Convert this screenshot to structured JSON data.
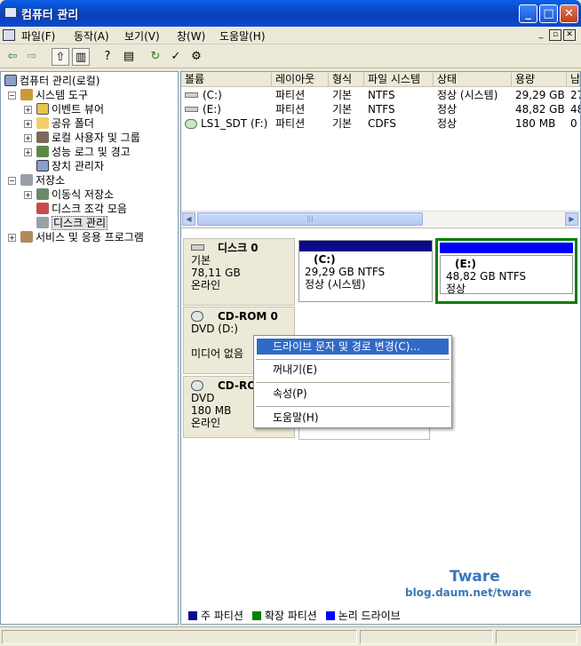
{
  "window": {
    "title": "컴퓨터 관리"
  },
  "menu": [
    "파일(F)",
    "동작(A)",
    "보기(V)",
    "창(W)",
    "도움말(H)"
  ],
  "colors": {
    "primary": "#0A0A8A",
    "extended": "#008000",
    "logical": "#0000FF",
    "selected_border": "#008000",
    "highlight": "#316AC5"
  },
  "tree": {
    "root": "컴퓨터 관리(로컬)",
    "system_tools": "시스템 도구",
    "event_viewer": "이벤트 뷰어",
    "shared_folders": "공유 폴더",
    "local_users": "로컬 사용자 및 그룹",
    "perf_logs": "성능 로그 및 경고",
    "device_manager": "장치 관리자",
    "storage": "저장소",
    "removable": "이동식 저장소",
    "defrag": "디스크 조각 모음",
    "disk_mgmt": "디스크 관리",
    "services": "서비스 및 응용 프로그램"
  },
  "volume_list": {
    "headers": [
      "볼륨",
      "레이아웃",
      "형식",
      "파일 시스템",
      "상태",
      "용량",
      "남"
    ],
    "rows": [
      [
        "(C:)",
        "파티션",
        "기본",
        "NTFS",
        "정상 (시스템)",
        "29,29 GB",
        "27"
      ],
      [
        "(E:)",
        "파티션",
        "기본",
        "NTFS",
        "정상",
        "48,82 GB",
        "48"
      ],
      [
        "LS1_SDT (F:)",
        "파티션",
        "기본",
        "CDFS",
        "정상",
        "180 MB",
        "0"
      ]
    ]
  },
  "disks": [
    {
      "name": "디스크 0",
      "type": "기본",
      "size": "78,11 GB",
      "status": "온라인",
      "partitions": [
        {
          "label": "(C:)",
          "info": "29,29 GB NTFS",
          "status": "정상 (시스템)"
        },
        {
          "label": "(E:)",
          "info": "48,82 GB NTFS",
          "status": "정상"
        }
      ]
    },
    {
      "name": "CD-ROM 0",
      "type": "DVD (D:)",
      "size": "",
      "status": "미디어 없음"
    },
    {
      "name": "CD-RO",
      "type": "DVD",
      "size": "180 MB",
      "status": "온라인"
    }
  ],
  "context_menu": [
    "드라이브 문자 및 경로 변경(C)...",
    "꺼내기(E)",
    "속성(P)",
    "도움말(H)"
  ],
  "legend": [
    "주 파티션",
    "확장 파티션",
    "논리 드라이브"
  ],
  "watermark": {
    "title": "Tware",
    "url": "blog.daum.net/tware"
  }
}
